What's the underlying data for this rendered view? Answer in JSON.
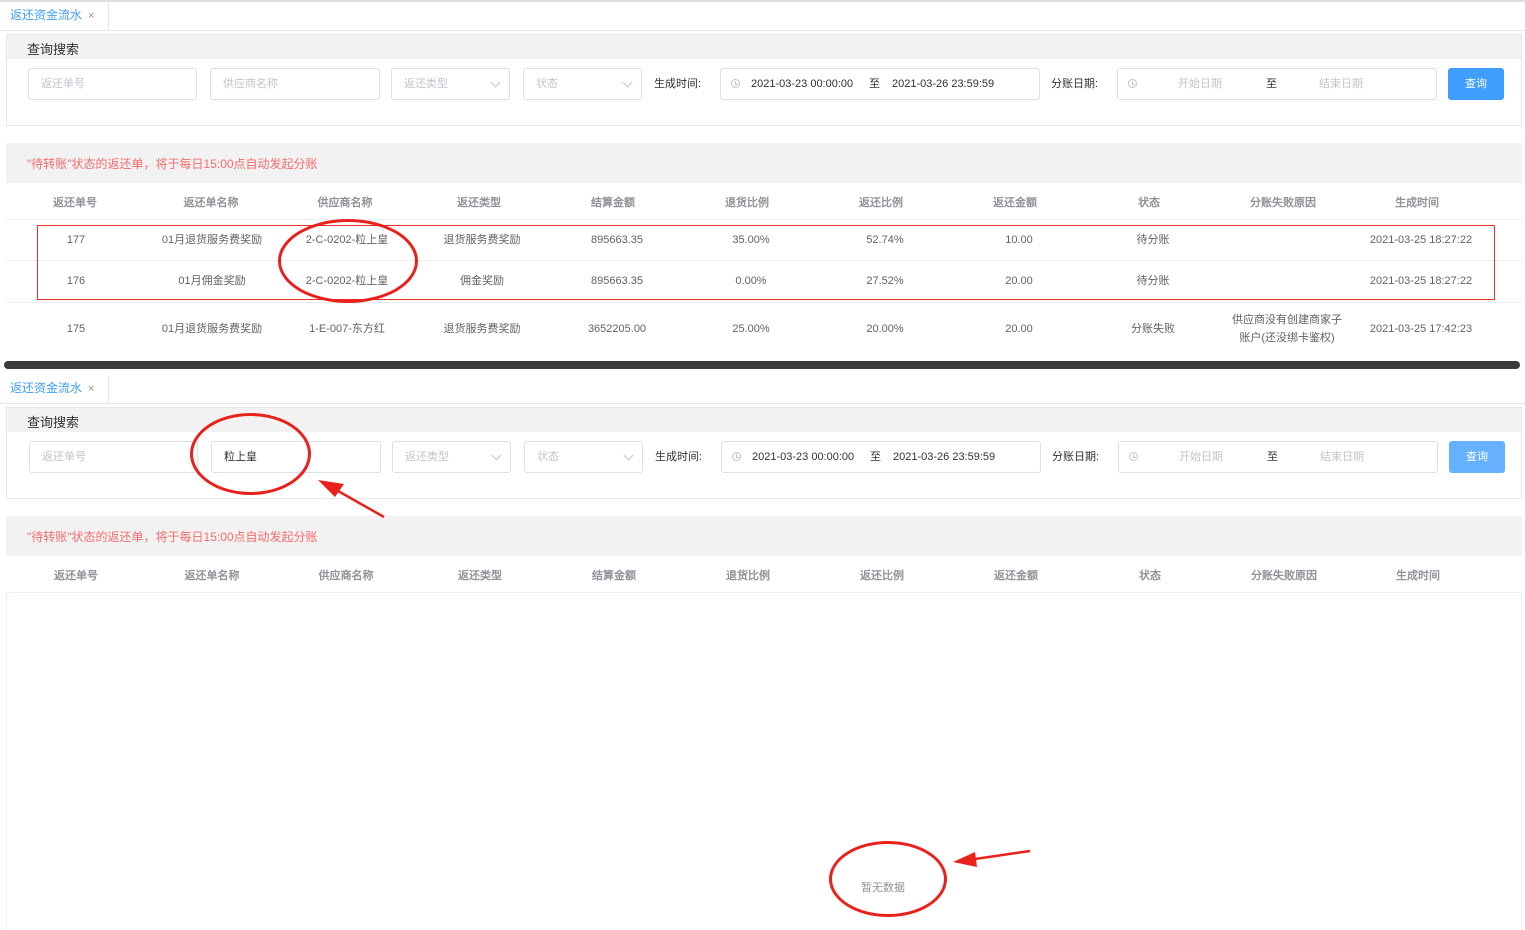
{
  "tab": {
    "title": "返还资金流水",
    "close": "×"
  },
  "search": {
    "section_title": "查询搜索",
    "refund_no_placeholder": "返还单号",
    "supplier_placeholder": "供应商名称",
    "supplier_value_bottom": "粒上皇",
    "type_placeholder": "返还类型",
    "status_placeholder": "状态",
    "created_label": "生成时间:",
    "created_start": "2021-03-23 00:00:00",
    "created_sep": "至",
    "created_end": "2021-03-26 23:59:59",
    "split_label": "分账日期:",
    "split_start_placeholder": "开始日期",
    "split_sep": "至",
    "split_end_placeholder": "结束日期",
    "query_button": "查询"
  },
  "notice": "\"待转账\"状态的返还单，将于每日15:00点自动发起分账",
  "columns": [
    "返还单号",
    "返还单名称",
    "供应商名称",
    "返还类型",
    "结算金额",
    "退货比例",
    "返还比例",
    "返还金额",
    "状态",
    "分账失败原因",
    "生成时间"
  ],
  "rows": [
    {
      "id": "177",
      "name": "01月退货服务费奖励",
      "supplier": "2-C-0202-粒上皇",
      "type": "退货服务费奖励",
      "amount": "895663.35",
      "return_ratio": "35.00%",
      "refund_ratio": "52.74%",
      "refund_amount": "10.00",
      "status": "待分账",
      "fail_reason_1": "",
      "fail_reason_2": "",
      "created": "2021-03-25 18:27:22"
    },
    {
      "id": "176",
      "name": "01月佣金奖励",
      "supplier": "2-C-0202-粒上皇",
      "type": "佣金奖励",
      "amount": "895663.35",
      "return_ratio": "0.00%",
      "refund_ratio": "27.52%",
      "refund_amount": "20.00",
      "status": "待分账",
      "fail_reason_1": "",
      "fail_reason_2": "",
      "created": "2021-03-25 18:27:22"
    },
    {
      "id": "175",
      "name": "01月退货服务费奖励",
      "supplier": "1-E-007-东方红",
      "type": "退货服务费奖励",
      "amount": "3652205.00",
      "return_ratio": "25.00%",
      "refund_ratio": "20.00%",
      "refund_amount": "20.00",
      "status": "分账失败",
      "fail_reason_1": "供应商没有创建商家子",
      "fail_reason_2": "账户(还没绑卡鉴权)",
      "created": "2021-03-25 17:42:23"
    }
  ],
  "empty_text": "暂无数据",
  "colors": {
    "accent": "#409eff",
    "accent_light": "#66b1ff",
    "notice_red": "#f56c6c",
    "annotation_red": "#e8211b"
  }
}
